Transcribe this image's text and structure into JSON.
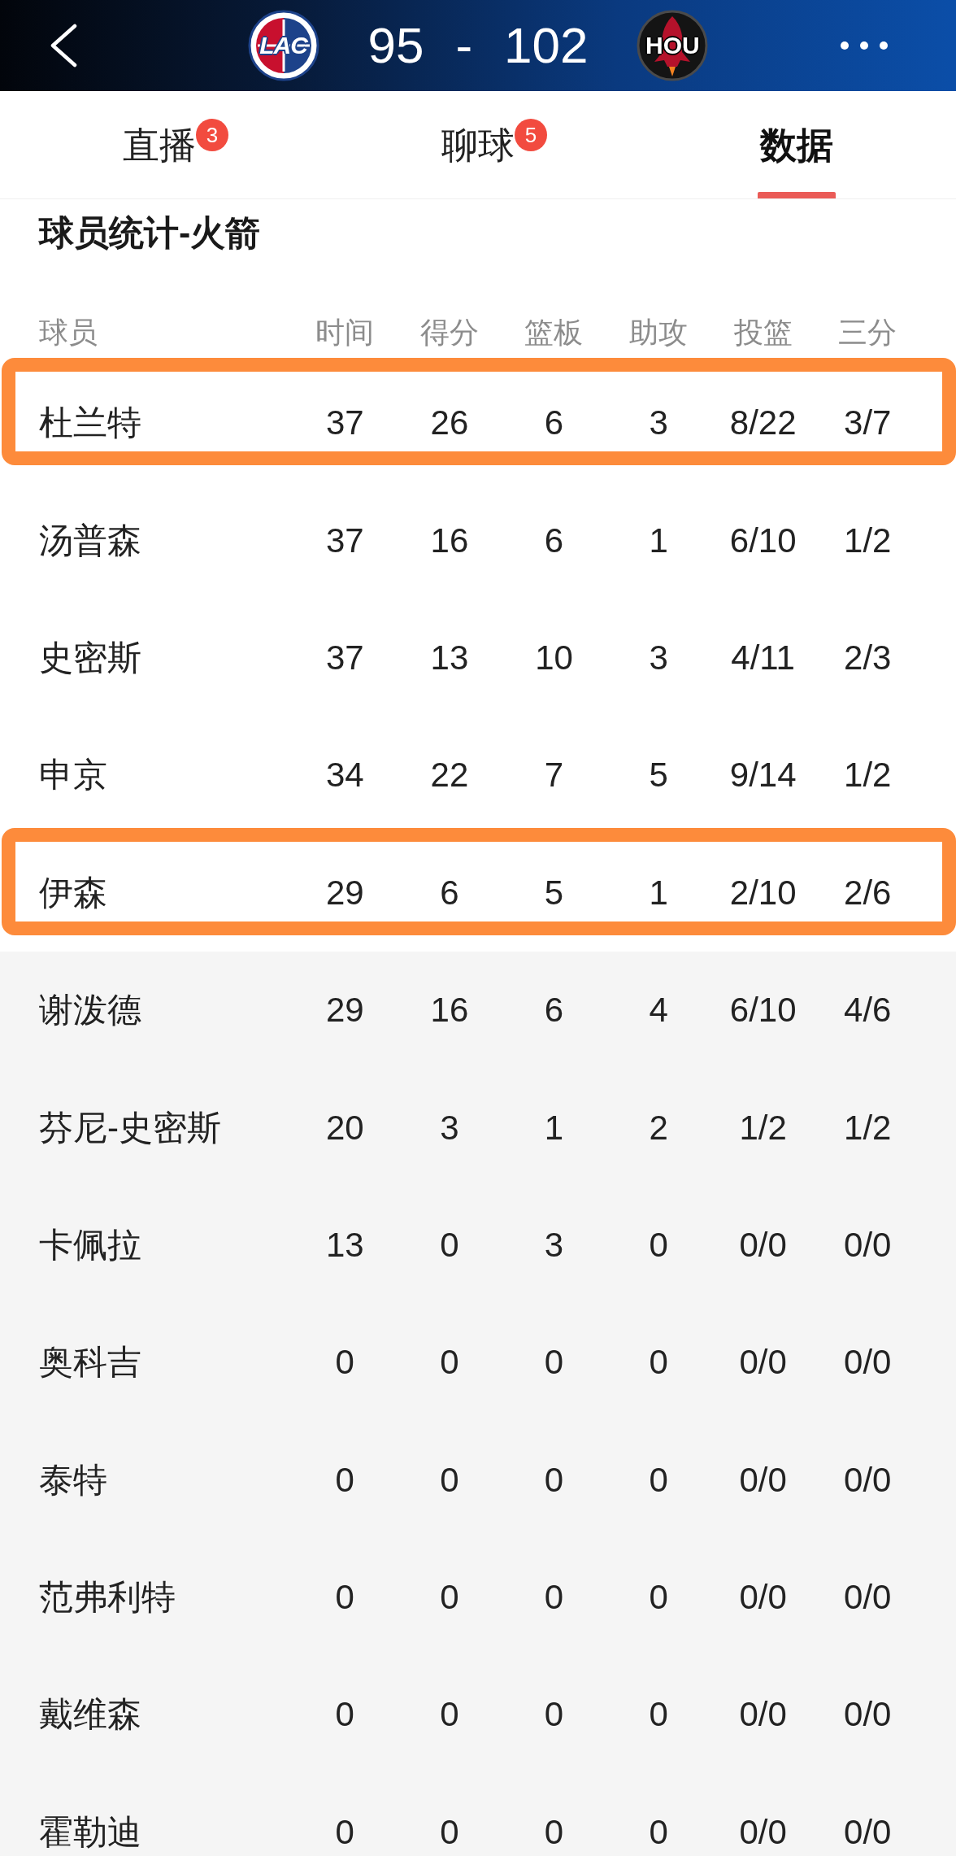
{
  "header": {
    "home_team": {
      "abbr": "LAC"
    },
    "score": "95 - 102",
    "away_team": {
      "abbr": "HOU"
    }
  },
  "tabs": [
    {
      "label": "直播",
      "badge": "3",
      "selected": false
    },
    {
      "label": "聊球",
      "badge": "5",
      "selected": false
    },
    {
      "label": "数据",
      "selected": true
    }
  ],
  "section_title": "球员统计-火箭",
  "table": {
    "columns": [
      "球员",
      "时间",
      "得分",
      "篮板",
      "助攻",
      "投篮",
      "三分"
    ],
    "rows": [
      {
        "player": "杜兰特",
        "stats": [
          "37",
          "26",
          "6",
          "3",
          "8/22",
          "3/7"
        ],
        "highlighted": true,
        "shaded": false
      },
      {
        "player": "汤普森",
        "stats": [
          "37",
          "16",
          "6",
          "1",
          "6/10",
          "1/2"
        ],
        "highlighted": false,
        "shaded": false
      },
      {
        "player": "史密斯",
        "stats": [
          "37",
          "13",
          "10",
          "3",
          "4/11",
          "2/3"
        ],
        "highlighted": false,
        "shaded": false
      },
      {
        "player": "申京",
        "stats": [
          "34",
          "22",
          "7",
          "5",
          "9/14",
          "1/2"
        ],
        "highlighted": false,
        "shaded": false
      },
      {
        "player": "伊森",
        "stats": [
          "29",
          "6",
          "5",
          "1",
          "2/10",
          "2/6"
        ],
        "highlighted": true,
        "shaded": false
      },
      {
        "player": "谢泼德",
        "stats": [
          "29",
          "16",
          "6",
          "4",
          "6/10",
          "4/6"
        ],
        "highlighted": false,
        "shaded": true
      },
      {
        "player": "芬尼-史密斯",
        "stats": [
          "20",
          "3",
          "1",
          "2",
          "1/2",
          "1/2"
        ],
        "highlighted": false,
        "shaded": true
      },
      {
        "player": "卡佩拉",
        "stats": [
          "13",
          "0",
          "3",
          "0",
          "0/0",
          "0/0"
        ],
        "highlighted": false,
        "shaded": true
      },
      {
        "player": "奥科吉",
        "stats": [
          "0",
          "0",
          "0",
          "0",
          "0/0",
          "0/0"
        ],
        "highlighted": false,
        "shaded": true
      },
      {
        "player": "泰特",
        "stats": [
          "0",
          "0",
          "0",
          "0",
          "0/0",
          "0/0"
        ],
        "highlighted": false,
        "shaded": true
      },
      {
        "player": "范弗利特",
        "stats": [
          "0",
          "0",
          "0",
          "0",
          "0/0",
          "0/0"
        ],
        "highlighted": false,
        "shaded": true
      },
      {
        "player": "戴维森",
        "stats": [
          "0",
          "0",
          "0",
          "0",
          "0/0",
          "0/0"
        ],
        "highlighted": false,
        "shaded": true
      },
      {
        "player": "霍勒迪",
        "stats": [
          "0",
          "0",
          "0",
          "0",
          "0/0",
          "0/0"
        ],
        "highlighted": false,
        "shaded": true
      }
    ]
  }
}
